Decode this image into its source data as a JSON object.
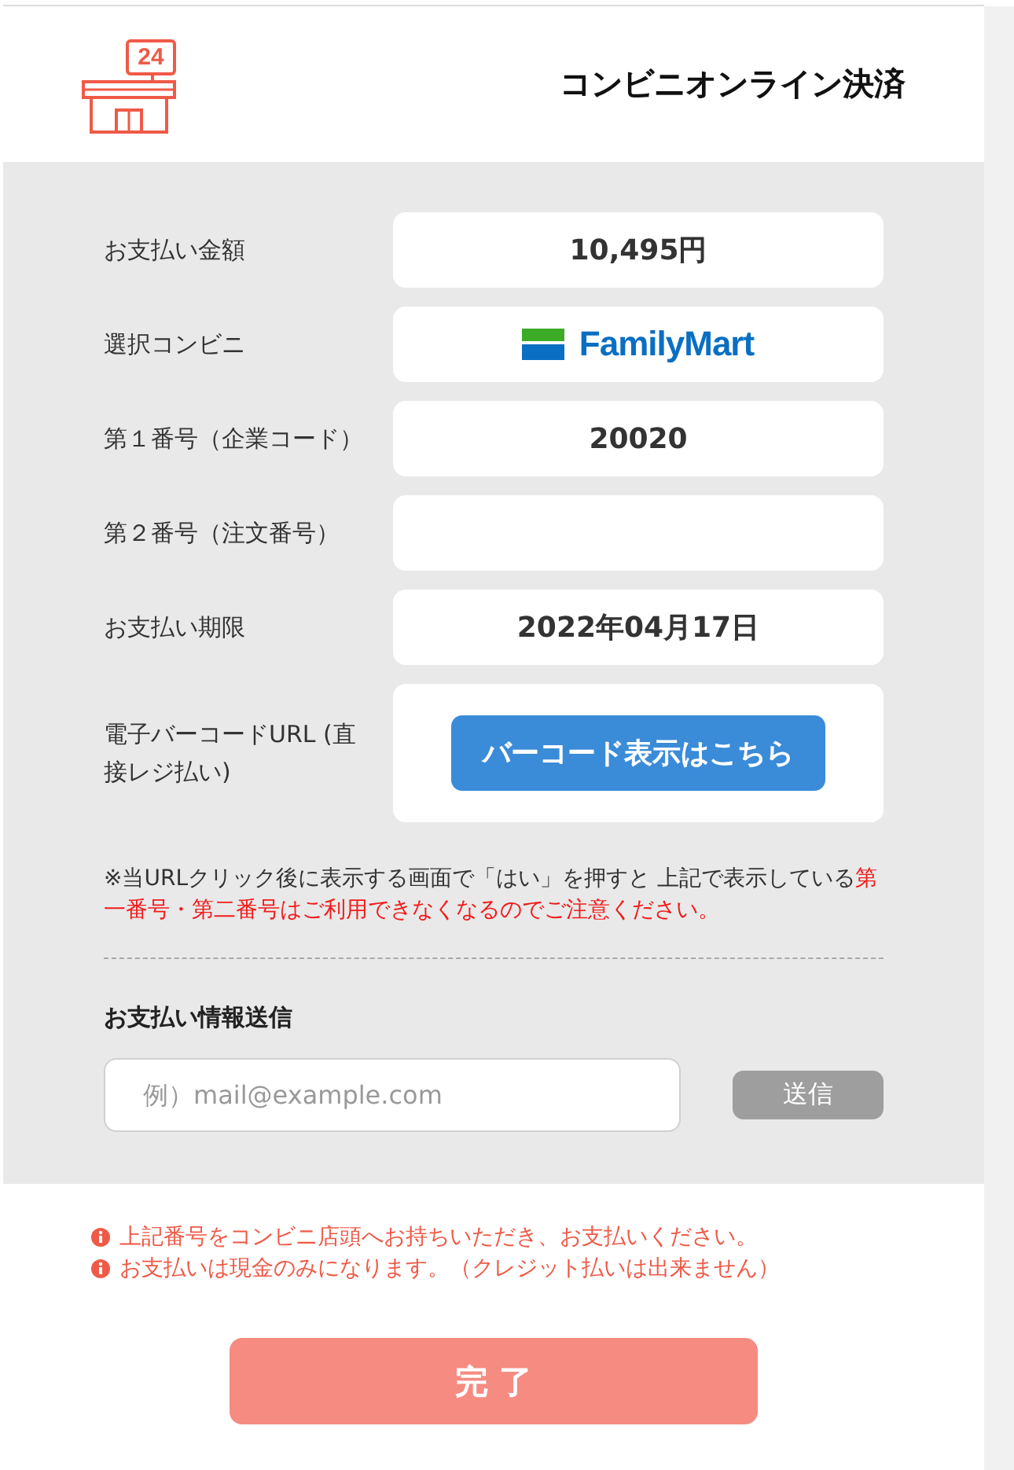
{
  "header": {
    "sign": "24",
    "title": "コンビニオンライン決済"
  },
  "details": [
    {
      "kind": "text",
      "label": "お支払い金額",
      "value": "10,495円"
    },
    {
      "kind": "logo",
      "label": "選択コンビニ",
      "logo_text": "FamilyMart"
    },
    {
      "kind": "text",
      "label": "第１番号（企業コード）",
      "value": "20020"
    },
    {
      "kind": "text",
      "label": "第２番号（注文番号）"
    },
    {
      "kind": "text",
      "label": "お支払い期限",
      "value": "2022年04月17日"
    },
    {
      "kind": "button",
      "label": "電子バーコードURL (直接レジ払い)",
      "button": "バーコード表示はこちら"
    }
  ],
  "note": {
    "text": "※当URLクリック後に表示する画面で「はい」を押すと 上記で表示している",
    "warning": "第一番号・第二番号はご利用できなくなるのでご注意ください。"
  },
  "payment_info": {
    "title": "お支払い情報送信",
    "email": {
      "placeholder": "例）mail@example.com"
    },
    "send": {
      "label": "送信",
      "disabled": true
    }
  },
  "notices": [
    "上記番号をコンビニ店頭へお持ちいただき、お支払いください。",
    "お支払いは現金のみになります。（クレジット払いは出来ません）"
  ],
  "complete_button": {
    "label": "完 了"
  }
}
